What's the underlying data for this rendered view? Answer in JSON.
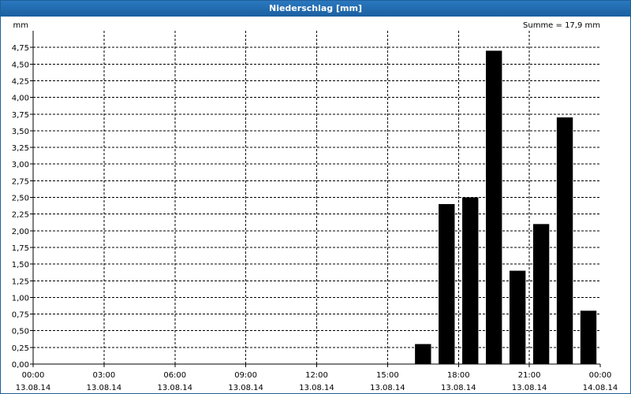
{
  "window": {
    "title": "Niederschlag [mm]"
  },
  "chart_data": {
    "type": "bar",
    "title": "Niederschlag [mm]",
    "ylabel": "mm",
    "summary": "Summe = 17,9 mm",
    "ylim": [
      0,
      5.0
    ],
    "yticks": [
      "0,00",
      "0,25",
      "0,50",
      "0,75",
      "1,00",
      "1,25",
      "1,50",
      "1,75",
      "2,00",
      "2,25",
      "2,50",
      "2,75",
      "3,00",
      "3,25",
      "3,50",
      "3,75",
      "4,00",
      "4,25",
      "4,50",
      "4,75"
    ],
    "xlim_hours": [
      0,
      24
    ],
    "xticks": [
      {
        "time": "00:00",
        "date": "13.08.14"
      },
      {
        "time": "03:00",
        "date": "13.08.14"
      },
      {
        "time": "06:00",
        "date": "13.08.14"
      },
      {
        "time": "09:00",
        "date": "13.08.14"
      },
      {
        "time": "12:00",
        "date": "13.08.14"
      },
      {
        "time": "15:00",
        "date": "13.08.14"
      },
      {
        "time": "18:00",
        "date": "13.08.14"
      },
      {
        "time": "21:00",
        "date": "13.08.14"
      },
      {
        "time": "00:00",
        "date": "14.08.14"
      }
    ],
    "grid": true,
    "bar_color": "#000000",
    "bars": [
      {
        "hour": 16.5,
        "value": 0.3
      },
      {
        "hour": 17.5,
        "value": 2.4
      },
      {
        "hour": 18.5,
        "value": 2.5
      },
      {
        "hour": 19.5,
        "value": 4.7
      },
      {
        "hour": 20.5,
        "value": 1.4
      },
      {
        "hour": 21.5,
        "value": 2.1
      },
      {
        "hour": 22.5,
        "value": 3.7
      },
      {
        "hour": 23.5,
        "value": 0.8
      }
    ]
  }
}
